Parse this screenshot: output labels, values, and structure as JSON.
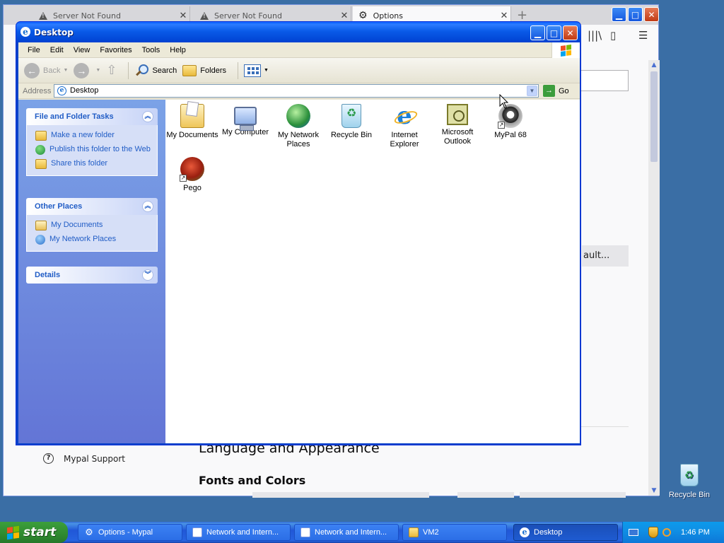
{
  "browser": {
    "tabs": [
      {
        "label": "Server Not Found"
      },
      {
        "label": "Server Not Found"
      },
      {
        "label": "Options"
      }
    ],
    "button_text": "ault...",
    "heading_language": "Language and Appearance",
    "heading_fonts": "Fonts and Colors",
    "support_link": "Mypal Support"
  },
  "explorer": {
    "title": "Desktop",
    "menu": [
      "File",
      "Edit",
      "View",
      "Favorites",
      "Tools",
      "Help"
    ],
    "toolbar": {
      "back": "Back",
      "search": "Search",
      "folders": "Folders"
    },
    "address": {
      "label": "Address",
      "value": "Desktop",
      "go": "Go"
    },
    "panes": {
      "file_tasks": {
        "title": "File and Folder Tasks",
        "items": [
          "Make a new folder",
          "Publish this folder to the Web",
          "Share this folder"
        ]
      },
      "other_places": {
        "title": "Other Places",
        "items": [
          "My Documents",
          "My Network Places"
        ]
      },
      "details": {
        "title": "Details"
      }
    },
    "icons": [
      {
        "label": "My Documents",
        "icon": "my-documents-icon"
      },
      {
        "label": "My Computer",
        "icon": "my-computer-icon"
      },
      {
        "label": "My Network Places",
        "icon": "my-network-places-icon"
      },
      {
        "label": "Recycle Bin",
        "icon": "recycle-bin-icon"
      },
      {
        "label": "Internet Explorer",
        "icon": "internet-explorer-icon"
      },
      {
        "label": "Microsoft Outlook",
        "icon": "outlook-icon"
      },
      {
        "label": "MyPal 68",
        "icon": "mypal-icon"
      },
      {
        "label": "Pego",
        "icon": "pego-icon"
      }
    ]
  },
  "desktop": {
    "recycle_bin": "Recycle Bin"
  },
  "taskbar": {
    "start": "start",
    "buttons": [
      {
        "label": "Options - Mypal"
      },
      {
        "label": "Network and Intern..."
      },
      {
        "label": "Network and Intern..."
      },
      {
        "label": "VM2"
      },
      {
        "label": "Desktop"
      }
    ],
    "clock": "1:46 PM"
  },
  "colors": {
    "xp_blue": "#0a5be8",
    "taskbar_blue": "#2157d7",
    "start_green": "#3c9f3c",
    "pane_link": "#215dc6",
    "desktop_bg": "#3a6ea5"
  }
}
